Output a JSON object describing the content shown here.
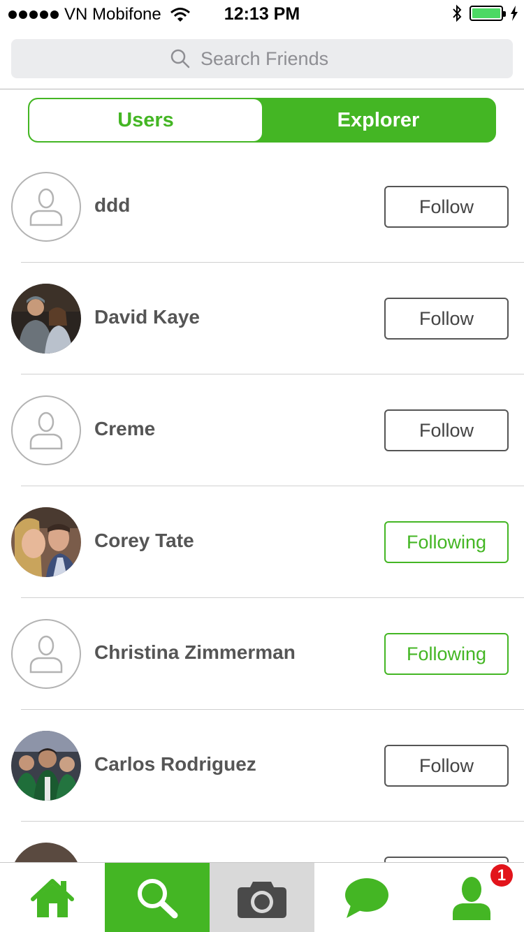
{
  "status_bar": {
    "carrier": "VN Mobifone",
    "time": "12:13 PM"
  },
  "search": {
    "placeholder": "Search Friends",
    "icon": "search-icon"
  },
  "segments": {
    "users_label": "Users",
    "explorer_label": "Explorer",
    "selected": "Explorer"
  },
  "users": [
    {
      "name": "ddd",
      "avatar": "placeholder",
      "button": "Follow",
      "following": false
    },
    {
      "name": "David Kaye",
      "avatar": "photo",
      "button": "Follow",
      "following": false
    },
    {
      "name": "Creme",
      "avatar": "placeholder",
      "button": "Follow",
      "following": false
    },
    {
      "name": "Corey Tate",
      "avatar": "photo",
      "button": "Following",
      "following": true
    },
    {
      "name": "Christina Zimmerman",
      "avatar": "placeholder",
      "button": "Following",
      "following": true
    },
    {
      "name": "Carlos Rodriguez",
      "avatar": "photo",
      "button": "Follow",
      "following": false
    }
  ],
  "tab_bar": {
    "tabs": [
      "home-icon",
      "search-icon",
      "camera-icon",
      "chat-icon",
      "profile-icon"
    ],
    "active": "search",
    "profile_badge": "1"
  },
  "colors": {
    "accent": "#44b624",
    "badge": "#e2141b",
    "battery": "#4cd964"
  }
}
